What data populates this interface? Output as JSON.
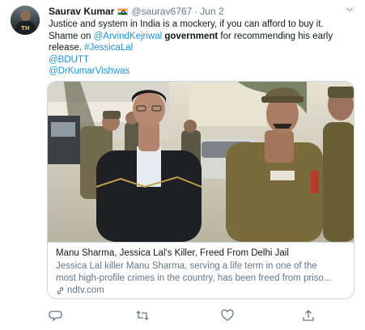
{
  "tweet": {
    "author_name": "Saurav Kumar",
    "author_handle": "@saurav6767",
    "separator": "·",
    "date": "Jun 2",
    "avatar_text": "TH",
    "line1": "Justice and system in India is a mockery, if you can afford to buy it.",
    "line2_pre": "Shame on ",
    "mention_kejriwal": "@ArvindKejriwal",
    "line2_bold": "government",
    "line2_post": " for recommending his early",
    "line3_pre": "release. ",
    "hashtag": "#JessicaLal",
    "mention_bdutt": "@BDUTT",
    "mention_vishwas": "@DrKumarVishwas"
  },
  "card": {
    "title": "Manu Sharma, Jessica Lal's Killer, Freed From Delhi Jail",
    "desc_line1": "Jessica Lal killer Manu Sharma, serving a life term in one of the",
    "desc_line2": "most high-profile crimes in the country, has been freed from priso...",
    "domain": "ndtv.com"
  },
  "icons": {
    "reply": "reply-icon",
    "retweet": "retweet-icon",
    "like": "like-icon",
    "share": "share-icon",
    "caret": "chevron-down-icon",
    "link": "link-icon"
  },
  "colors": {
    "link": "#1b95e0",
    "secondary_text": "#657786",
    "border": "#ccd6dd"
  }
}
